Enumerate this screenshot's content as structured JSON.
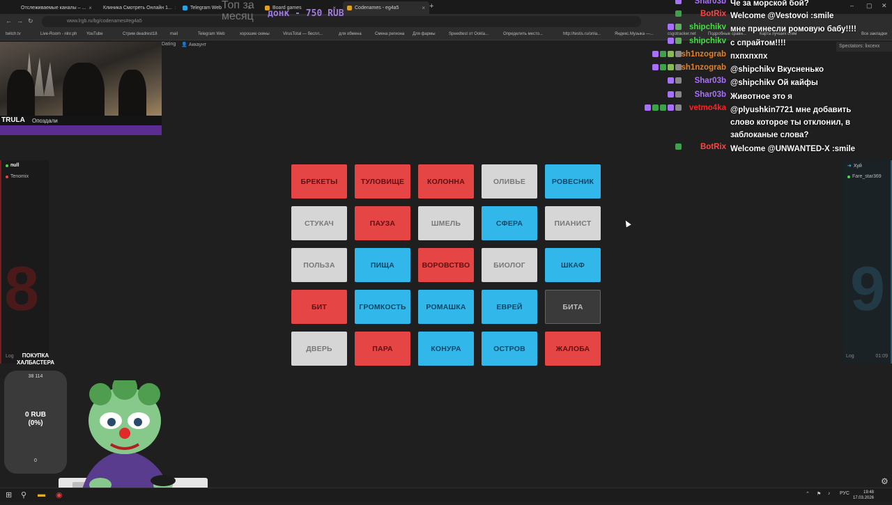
{
  "browser": {
    "tabs": [
      {
        "label": "Отслеживаемые каналы – ...",
        "fav": "#a970ff",
        "active": false
      },
      {
        "label": "Клиника Смотреть Онлайн 1...",
        "fav": "#3aa34a",
        "active": false
      },
      {
        "label": "Telegram Web",
        "fav": "#2aa3e0",
        "active": false
      },
      {
        "label": "Board games",
        "fav": "#e0a020",
        "active": false
      },
      {
        "label": "Codenames - eg4a5",
        "fav": "#e0a020",
        "active": true
      }
    ],
    "url": "www.lrgb.ru/bg/codenames#eg4a5",
    "bookmarks": [
      "twitch.tv",
      "Live-Room - nlnr.ph",
      "YouTube",
      "Стрим deadrest18",
      "mail",
      "Telegram Web",
      "хорошие скины",
      "VirusTotal — беспл...",
      "для обмена",
      "Смена региона",
      "Для фармы",
      "Speedtest от Ookla...",
      "Определить место...",
      "http://testis.ru/onla...",
      "Яндекс.Музыка —...",
      "csgotracker.net",
      "Подробные сравн...",
      "Карта лучших стим",
      "Все закладки"
    ]
  },
  "site_nav": {
    "dating": "Dating",
    "account": "Аккаунт",
    "spectators": "Spectators: lixcexx"
  },
  "overlay": {
    "top_text": "Топ за месяц",
    "donation": "донк - 750 RUB"
  },
  "webcam": {
    "streamer": "TRULA",
    "status": "Опоздали"
  },
  "chat": [
    {
      "user": "Shar03b",
      "color": "#a970ff",
      "text": "Че за морской бой?",
      "badges": [
        "#a970ff"
      ]
    },
    {
      "user": "BotRix",
      "color": "#ff4444",
      "text": "Welcome @Vestovoi :smile",
      "badges": [
        "#3aa34a"
      ]
    },
    {
      "user": "shipchikv",
      "color": "#44dd44",
      "text": "мне принесли ромовую бабу!!!!",
      "badges": [
        "#a970ff",
        "#6a6"
      ]
    },
    {
      "user": "shipchikv",
      "color": "#44dd44",
      "text": "с спрайтом!!!!",
      "badges": [
        "#a970ff",
        "#6a6"
      ]
    },
    {
      "user": "sh1nzograb",
      "color": "#e0812c",
      "text": "пхпхпхпх",
      "badges": [
        "#a970ff",
        "#3aa34a",
        "#8b5",
        "#888"
      ]
    },
    {
      "user": "sh1nzograb",
      "color": "#e0812c",
      "text": "@shipchikv Вкусненько",
      "badges": [
        "#a970ff",
        "#3aa34a",
        "#8b5",
        "#888"
      ]
    },
    {
      "user": "Shar03b",
      "color": "#a970ff",
      "text": "@shipchikv Ой кайфы",
      "badges": [
        "#a970ff",
        "#888"
      ]
    },
    {
      "user": "Shar03b",
      "color": "#a970ff",
      "text": "Животное это я",
      "badges": [
        "#a970ff",
        "#888"
      ]
    },
    {
      "user": "vetmo4ka",
      "color": "#ff2020",
      "text": "@plyushkin7721 мне добавить слово которое ты отклонил, в заблоканые слова?",
      "badges": [
        "#a970ff",
        "#3aa34a",
        "#3aa34a",
        "#a970ff",
        "#888"
      ]
    },
    {
      "user": "BotRix",
      "color": "#ff4444",
      "text": "Welcome @UNWANTED-X :smile",
      "badges": [
        "#3aa34a"
      ]
    }
  ],
  "red_team": {
    "players": [
      {
        "name": "null",
        "dot": "#44dd44"
      },
      {
        "name": "Tenomix",
        "dot": "#e54545"
      }
    ],
    "score": "8",
    "log": "Log"
  },
  "blue_team": {
    "players": [
      {
        "name": "Хуй",
        "dot": "#32b7eb"
      },
      {
        "name": "Fare_star369",
        "dot": "#44dd44"
      }
    ],
    "score": "9",
    "log": "Log",
    "timer": "01:09"
  },
  "board": [
    {
      "word": "БРЕКЕТЫ",
      "color": "red"
    },
    {
      "word": "ТУЛОВИЩЕ",
      "color": "red"
    },
    {
      "word": "КОЛОННА",
      "color": "red"
    },
    {
      "word": "ОЛИВЬЕ",
      "color": "neutral"
    },
    {
      "word": "РОВЕСНИК",
      "color": "blue"
    },
    {
      "word": "СТУКАЧ",
      "color": "neutral"
    },
    {
      "word": "ПАУЗА",
      "color": "red"
    },
    {
      "word": "ШМЕЛЬ",
      "color": "neutral"
    },
    {
      "word": "СФЕРА",
      "color": "blue"
    },
    {
      "word": "ПИАНИСТ",
      "color": "neutral"
    },
    {
      "word": "ПОЛЬЗА",
      "color": "neutral"
    },
    {
      "word": "ПИЩА",
      "color": "blue"
    },
    {
      "word": "ВОРОВСТВО",
      "color": "red"
    },
    {
      "word": "БИОЛОГ",
      "color": "neutral"
    },
    {
      "word": "ШКАФ",
      "color": "blue"
    },
    {
      "word": "БИТ",
      "color": "red"
    },
    {
      "word": "ГРОМКОСТЬ",
      "color": "blue"
    },
    {
      "word": "РОМАШКА",
      "color": "blue"
    },
    {
      "word": "ЕВРЕЙ",
      "color": "blue"
    },
    {
      "word": "БИТА",
      "color": "black"
    },
    {
      "word": "ДВЕРЬ",
      "color": "neutral"
    },
    {
      "word": "ПАРА",
      "color": "red"
    },
    {
      "word": "КОНУРА",
      "color": "blue"
    },
    {
      "word": "ОСТРОВ",
      "color": "blue"
    },
    {
      "word": "ЖАЛОБА",
      "color": "red"
    }
  ],
  "goal": {
    "title": "ПОКУПКА ХАЛБАСТЕРА",
    "target": "38 114",
    "amount": "0 RUB",
    "percent": "(0%)",
    "min": "0"
  },
  "taskbar": {
    "time": "19:48",
    "date": "17.03.2026",
    "lang": "РУС"
  }
}
